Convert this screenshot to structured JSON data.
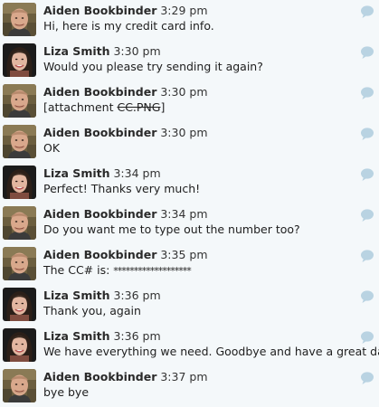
{
  "messages": [
    {
      "sender": "Aiden Bookbinder",
      "time": "3:29 pm",
      "avatar": "aiden",
      "parts": [
        {
          "t": "Hi, here is my credit card info."
        }
      ]
    },
    {
      "sender": "Liza Smith",
      "time": "3:30 pm",
      "avatar": "liza",
      "parts": [
        {
          "t": "Would you please try sending it again?"
        }
      ]
    },
    {
      "sender": "Aiden Bookbinder",
      "time": "3:30 pm",
      "avatar": "aiden",
      "parts": [
        {
          "t": "[attachment "
        },
        {
          "t": "CC.PNG",
          "strike": true
        },
        {
          "t": "]"
        }
      ]
    },
    {
      "sender": "Aiden Bookbinder",
      "time": "3:30 pm",
      "avatar": "aiden",
      "parts": [
        {
          "t": "OK"
        }
      ]
    },
    {
      "sender": "Liza Smith",
      "time": "3:34 pm",
      "avatar": "liza",
      "parts": [
        {
          "t": "Perfect! Thanks very much!"
        }
      ]
    },
    {
      "sender": "Aiden Bookbinder",
      "time": "3:34 pm",
      "avatar": "aiden",
      "parts": [
        {
          "t": "Do you want me to type out the number too?"
        }
      ]
    },
    {
      "sender": "Aiden Bookbinder",
      "time": "3:35 pm",
      "avatar": "aiden",
      "parts": [
        {
          "t": "The CC# is: "
        },
        {
          "t": "*******************",
          "stars": true
        }
      ]
    },
    {
      "sender": "Liza Smith",
      "time": "3:36 pm",
      "avatar": "liza",
      "parts": [
        {
          "t": "Thank you, again"
        }
      ]
    },
    {
      "sender": "Liza Smith",
      "time": "3:36 pm",
      "avatar": "liza",
      "parts": [
        {
          "t": "We have everything we need. Goodbye and have a great day!"
        }
      ]
    },
    {
      "sender": "Aiden Bookbinder",
      "time": "3:37 pm",
      "avatar": "aiden",
      "parts": [
        {
          "t": "bye bye"
        }
      ]
    }
  ],
  "icons": {
    "reply": "speech-bubble-icon"
  },
  "colors": {
    "background": "#f4f8fa",
    "bubble_icon": "#b9d3e2"
  }
}
